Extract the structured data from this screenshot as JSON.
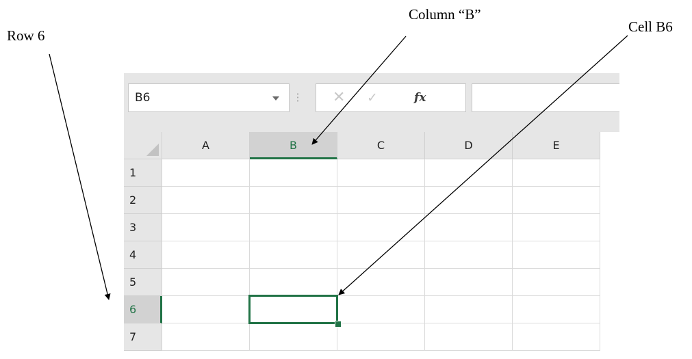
{
  "annotations": {
    "row": "Row 6",
    "column": "Column “B”",
    "cell": "Cell B6"
  },
  "formula_bar": {
    "name_box": "B6",
    "cancel_icon": "✕",
    "enter_icon": "✓",
    "fx_label": "fx",
    "formula_value": ""
  },
  "columns": [
    "A",
    "B",
    "C",
    "D",
    "E"
  ],
  "rows": [
    "1",
    "2",
    "3",
    "4",
    "5",
    "6",
    "7"
  ],
  "selection": {
    "column": "B",
    "row": "6"
  },
  "colors": {
    "accent": "#217346",
    "header_bg": "#e6e6e6",
    "selected_header_bg": "#d2d2d2"
  }
}
